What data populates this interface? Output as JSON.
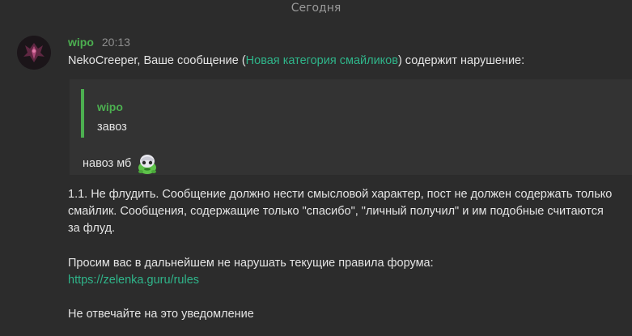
{
  "date_separator": "Сегодня",
  "message": {
    "author": "wipo",
    "time": "20:13",
    "intro": {
      "before": "NekoCreeper, Ваше сообщение (",
      "link": "Новая категория смайликов",
      "after": ") содержит нарушение:"
    },
    "quote": {
      "author": "wipo",
      "text": "завоз",
      "reply_text": "навоз мб",
      "sticker_icon": "frog-sticker-icon"
    },
    "rule": "1.1. Не флудить. Сообщение должно нести смысловой характер, пост не должен содержать только смайлик. Сообщения, содержащие только \"спасибо\", \"личный получил\" и им подобные считаются за флуд.",
    "request": "Просим вас в дальнейшем не нарушать текущие правила форума:",
    "rules_link": "https://zelenka.guru/rules",
    "footer": "Не отвечайте на это уведомление"
  },
  "colors": {
    "background": "#2c2c2c",
    "author": "#4caf50",
    "link": "#2fb58a",
    "quote_bar": "#4caf50"
  }
}
